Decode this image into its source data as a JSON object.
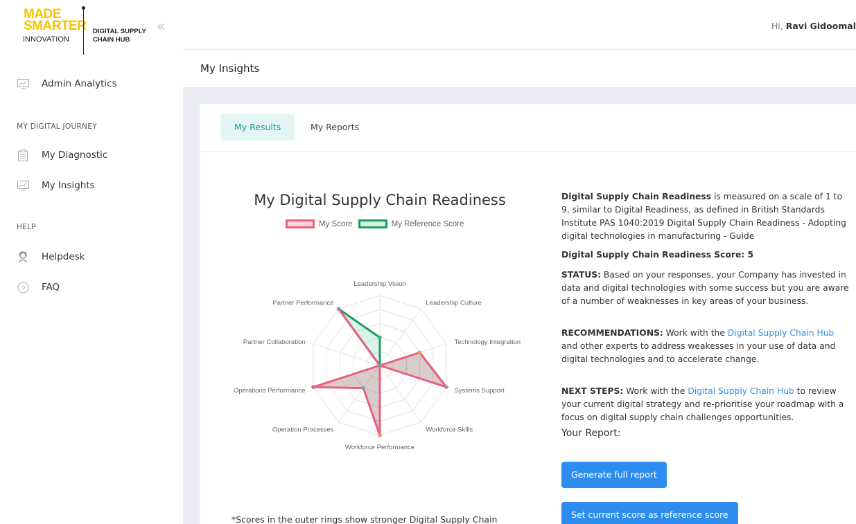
{
  "brand": {
    "logo_line1": "MADE",
    "logo_line2": "SMARTER",
    "logo_line3": "INNOVATION",
    "hub_line1": "DIGITAL SUPPLY",
    "hub_line2": "CHAIN HUB",
    "accent_yellow": "#f5c400"
  },
  "sidebar": {
    "collapse_icon": "«",
    "admin_item": {
      "label": "Admin Analytics",
      "icon": "chart-monitor-icon"
    },
    "section_journey": "MY DIGITAL JOURNEY",
    "journey_items": [
      {
        "label": "My Diagnostic",
        "icon": "clipboard-icon"
      },
      {
        "label": "My Insights",
        "icon": "chart-monitor-icon"
      }
    ],
    "section_help": "HELP",
    "help_items": [
      {
        "label": "Helpdesk",
        "icon": "headset-icon"
      },
      {
        "label": "FAQ",
        "icon": "question-circle-icon"
      }
    ]
  },
  "header": {
    "greeting_prefix": "Hi,",
    "user_name": "Ravi Gidoomal",
    "page_title": "My Insights"
  },
  "tabs": [
    {
      "label": "My Results",
      "active": true
    },
    {
      "label": "My Reports",
      "active": false
    }
  ],
  "chart_data": {
    "type": "radar",
    "title": "My Digital Supply Chain Readiness",
    "axes": [
      "Leadership Vision",
      "Leadership Culture",
      "Technology Integration",
      "Systems Support",
      "Workforce Skills",
      "Workforce Performance",
      "Operation Processes",
      "Operations Performance",
      "Partner Collaboration",
      "Partner Performance"
    ],
    "scale_max": 5,
    "rings": 5,
    "series": [
      {
        "name": "My Score",
        "values": [
          0,
          0,
          3,
          5,
          0,
          5,
          2,
          5,
          0,
          5
        ],
        "stroke": "#e8607a",
        "fill": "rgba(120,70,70,0.28)"
      },
      {
        "name": "My Reference Score",
        "values": [
          2,
          0,
          0,
          0,
          0,
          0,
          0,
          0,
          0,
          5
        ],
        "stroke": "#1f9d55",
        "fill": "rgba(80,200,170,0.22)"
      }
    ]
  },
  "info": {
    "intro_bold": "Digital Supply Chain Readiness",
    "intro_rest": " is measured on a scale of 1 to 9, similar to Digital Readiness, as defined in British Standards Institute PAS 1040:2019 Digital Supply Chain Readiness - Adopting digital technologies in manufacturing - Guide",
    "score_label": "Digital Supply Chain Readiness Score: 5",
    "status_label": "STATUS:",
    "status_text": " Based on your responses, your Company has invested in data and digital technologies with some success but you are aware of a number of weaknesses in key areas of your business.",
    "rec_label": "RECOMMENDATIONS:",
    "rec_pre": " Work with the ",
    "rec_link": "Digital Supply Chain Hub",
    "rec_post": " and other experts to address weakesses in your use of data and digital technologies and to accelerate change.",
    "next_label": "NEXT STEPS:",
    "next_pre": " Work with the ",
    "next_link": "Digital Supply Chain Hub",
    "next_post": " to review your current digital strategy and re-prioritise your roadmap with a focus on digital supply chain challenges opportunities.",
    "report_heading": "Your Report:"
  },
  "buttons": {
    "generate": "Generate full report",
    "set_reference": "Set current score as reference score"
  },
  "footnote": "*Scores in the outer rings show stronger Digital Supply Chain"
}
